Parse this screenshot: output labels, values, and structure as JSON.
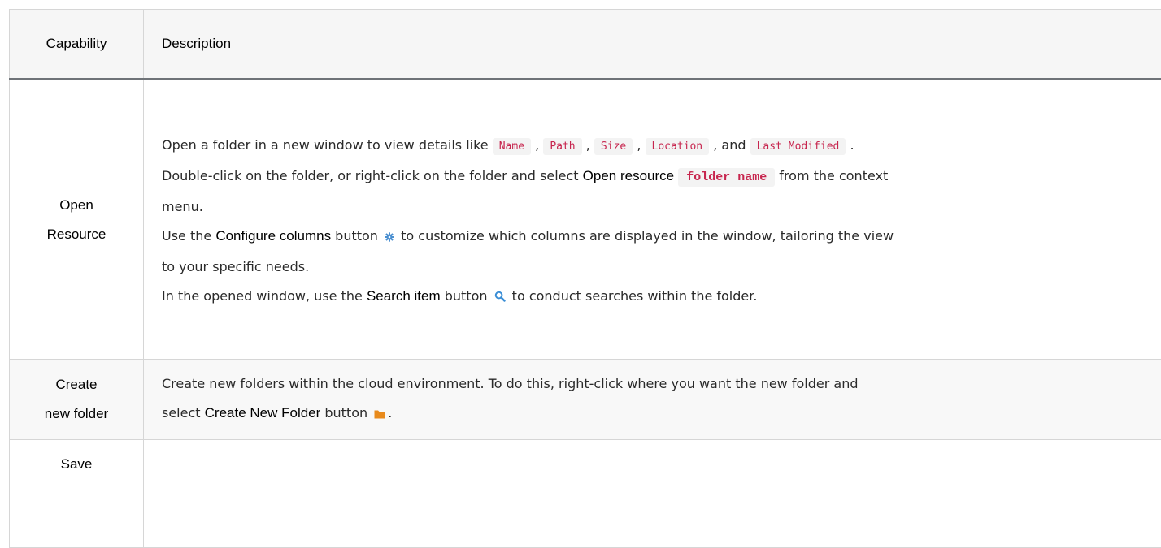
{
  "table": {
    "headers": {
      "capability": "Capability",
      "description": "Description"
    },
    "rows": [
      {
        "capability_line1": "Open",
        "capability_line2": "Resource",
        "l1_prefix": "Open a folder in a new window to view details like ",
        "tags": [
          "Name",
          "Path",
          "Size",
          "Location",
          "Last Modified"
        ],
        "sep": ",",
        "and": ", and",
        "end": ".",
        "l2_prefix": "Double-click on the folder, or right-click on the folder and select ",
        "l2_bold": "Open resource",
        "l2_code": "folder name",
        "l2_suffix": " from the context",
        "l3": "menu.",
        "l4_prefix": "Use the ",
        "l4_bold": "Configure columns",
        "l4_mid": " button",
        "l4_suffix": " to customize which columns are displayed in the window, tailoring the view",
        "l5": "to your specific needs.",
        "l6_prefix": "In the opened window, use the ",
        "l6_bold": "Search item",
        "l6_mid": " button",
        "l6_suffix": " to conduct searches within the folder."
      },
      {
        "capability_line1": "Create",
        "capability_line2": "new folder",
        "l1": "Create new folders within the cloud environment. To do this, right-click where you want the new folder and",
        "l2_prefix": "select ",
        "l2_bold": "Create New Folder",
        "l2_mid": " button",
        "l2_end": "."
      },
      {
        "capability_line1": "Save"
      }
    ]
  },
  "icons": {
    "configure": "gear-icon",
    "search": "search-icon",
    "folder": "folder-icon"
  },
  "colors": {
    "code_text": "#c7254e",
    "gear": "#4a8fd0",
    "search": "#3a8ed6",
    "folder": "#e88a1c"
  }
}
